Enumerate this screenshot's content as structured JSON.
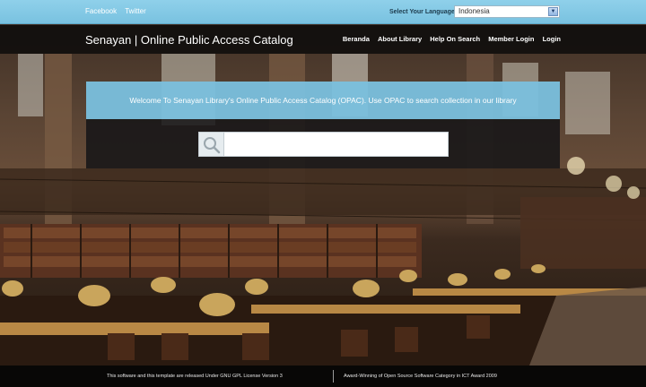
{
  "topbar": {
    "social_links": [
      "Facebook",
      "Twitter"
    ],
    "language_label": "Select Your Language",
    "language_selected": "Indonesia"
  },
  "header": {
    "site_title": "Senayan | Online Public Access Catalog",
    "nav": [
      "Beranda",
      "About Library",
      "Help On Search",
      "Member Login",
      "Login"
    ]
  },
  "welcome": {
    "text": "Welcome To Senayan Library's Online Public Access Catalog (OPAC). Use OPAC to search collection in our library"
  },
  "search": {
    "value": "",
    "icon": "search-icon"
  },
  "footer": {
    "license": "This software and this template are released Under GNU GPL License Version 3",
    "award": "Award-Winning of Open Source Software Category in ICT Award 2009"
  },
  "colors": {
    "topbar": "#79c2e0",
    "welcome_band": "#7ac0de",
    "header_bg": "#0a0a0a"
  }
}
